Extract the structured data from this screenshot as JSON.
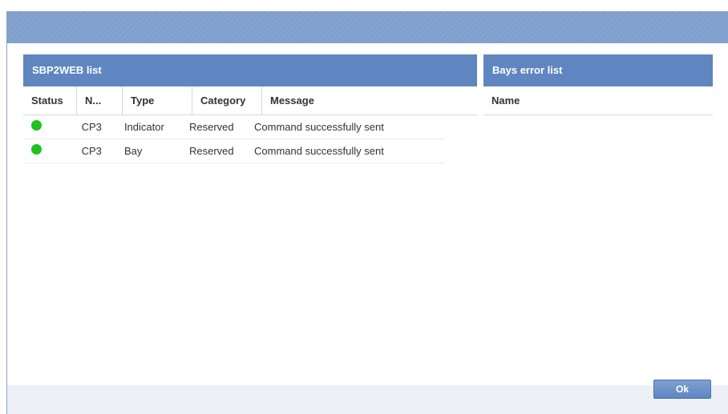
{
  "left_panel": {
    "title": "SBP2WEB list",
    "columns": [
      "Status",
      "N...",
      "Type",
      "Category",
      "Message"
    ],
    "rows": [
      {
        "status": "ok",
        "name": "CP3",
        "type": "Indicator",
        "category": "Reserved",
        "message": "Command successfully sent"
      },
      {
        "status": "ok",
        "name": "CP3",
        "type": "Bay",
        "category": "Reserved",
        "message": "Command successfully sent"
      }
    ]
  },
  "right_panel": {
    "title": "Bays error list",
    "columns": [
      "Name"
    ]
  },
  "footer": {
    "ok_label": "Ok"
  },
  "colors": {
    "title_bar": "#7f9fcc",
    "panel_header": "#5f86c1",
    "status_ok": "#1fc21f"
  }
}
